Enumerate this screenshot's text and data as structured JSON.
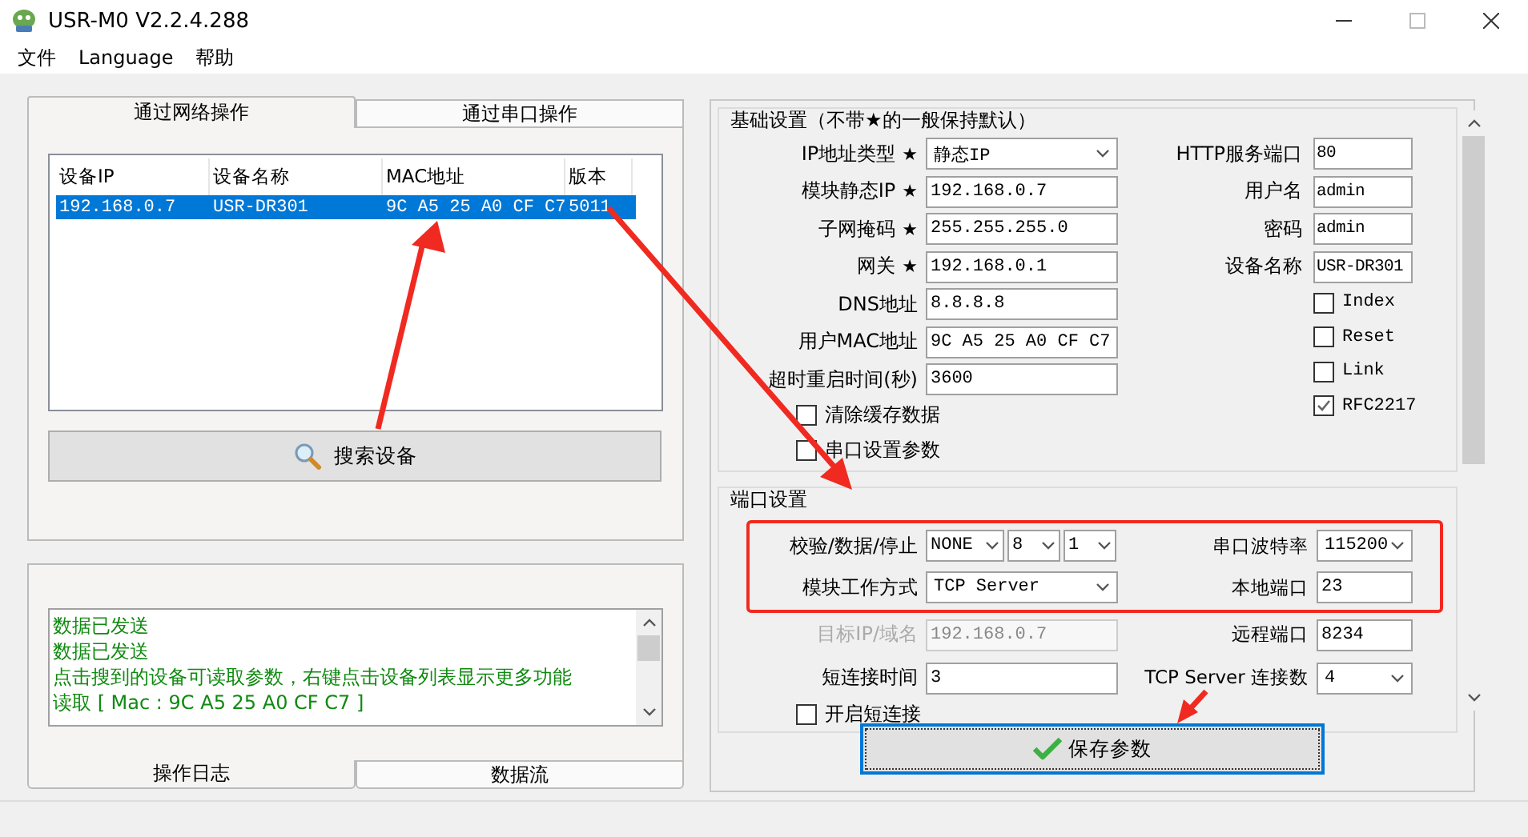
{
  "window": {
    "title": "USR-M0 V2.2.4.288"
  },
  "menu": [
    "文件",
    "Language",
    "帮助"
  ],
  "left": {
    "tabs": [
      {
        "label": "通过网络操作",
        "selected": true
      },
      {
        "label": "通过串口操作",
        "selected": false
      }
    ],
    "device_table": {
      "columns": [
        "设备IP",
        "设备名称",
        "MAC地址",
        "版本"
      ],
      "rows": [
        {
          "cells": [
            "192.168.0.7",
            "USR-DR301",
            "9C A5 25 A0 CF C7",
            "5011"
          ],
          "selected": true
        }
      ]
    },
    "search_button": "搜索设备",
    "log": [
      "数据已发送",
      "数据已发送",
      "点击搜到的设备可读取参数，右键点击设备列表显示更多功能",
      "读取 [ Mac : 9C A5 25 A0 CF C7 ]"
    ],
    "bottom_tabs": [
      {
        "label": "操作日志",
        "selected": true
      },
      {
        "label": "数据流",
        "selected": false
      }
    ]
  },
  "basic": {
    "title": "基础设置（不带★的一般保持默认）",
    "left_fields": [
      {
        "label": "IP地址类型",
        "star": "★",
        "kind": "select",
        "value": "静态IP"
      },
      {
        "label": "模块静态IP",
        "star": "★",
        "kind": "input",
        "value": "192.168.0.7"
      },
      {
        "label": "子网掩码",
        "star": "★",
        "kind": "input",
        "value": "255.255.255.0"
      },
      {
        "label": "网关",
        "star": "★",
        "kind": "input",
        "value": "192.168.0.1"
      },
      {
        "label": "DNS地址",
        "kind": "input",
        "value": "8.8.8.8"
      },
      {
        "label": "用户MAC地址",
        "kind": "input",
        "value": "9C A5 25 A0 CF C7"
      },
      {
        "label": "超时重启时间(秒)",
        "kind": "input",
        "value": "3600"
      }
    ],
    "left_checks": [
      {
        "label": "清除缓存数据",
        "checked": false
      },
      {
        "label": "串口设置参数",
        "checked": false
      }
    ],
    "right_fields": [
      {
        "label": "HTTP服务端口",
        "value": "80"
      },
      {
        "label": "用户名",
        "value": "admin"
      },
      {
        "label": "密码",
        "value": "admin"
      },
      {
        "label": "设备名称",
        "value": "USR-DR301"
      }
    ],
    "right_checks": [
      {
        "label": "Index",
        "checked": false
      },
      {
        "label": "Reset",
        "checked": false
      },
      {
        "label": "Link",
        "checked": false
      },
      {
        "label": "RFC2217",
        "checked": true
      }
    ]
  },
  "port": {
    "title": "端口设置",
    "rows": [
      {
        "left": {
          "label": "校验/数据/停止",
          "disabled": false,
          "controls": [
            {
              "kind": "select",
              "value": "NONE"
            },
            {
              "kind": "select",
              "value": "8"
            },
            {
              "kind": "select",
              "value": "1"
            }
          ]
        },
        "right": {
          "label": "串口波特率",
          "controls": [
            {
              "kind": "select",
              "value": "115200"
            }
          ]
        }
      },
      {
        "left": {
          "label": "模块工作方式",
          "disabled": false,
          "controls": [
            {
              "kind": "select",
              "value": "TCP Server"
            }
          ]
        },
        "right": {
          "label": "本地端口",
          "controls": [
            {
              "kind": "input",
              "value": "23"
            }
          ]
        }
      },
      {
        "left": {
          "label": "目标IP/域名",
          "disabled": true,
          "controls": [
            {
              "kind": "input",
              "value": "192.168.0.7"
            }
          ]
        },
        "right": {
          "label": "远程端口",
          "controls": [
            {
              "kind": "input",
              "value": "8234"
            }
          ]
        }
      },
      {
        "left": {
          "label": "短连接时间",
          "disabled": false,
          "controls": [
            {
              "kind": "input",
              "value": "3"
            }
          ]
        },
        "right": {
          "label": "TCP Server 连接数",
          "controls": [
            {
              "kind": "select",
              "value": "4"
            }
          ]
        }
      }
    ],
    "checks": [
      {
        "label": "开启短连接",
        "checked": false
      }
    ]
  },
  "save_button": "保存参数"
}
